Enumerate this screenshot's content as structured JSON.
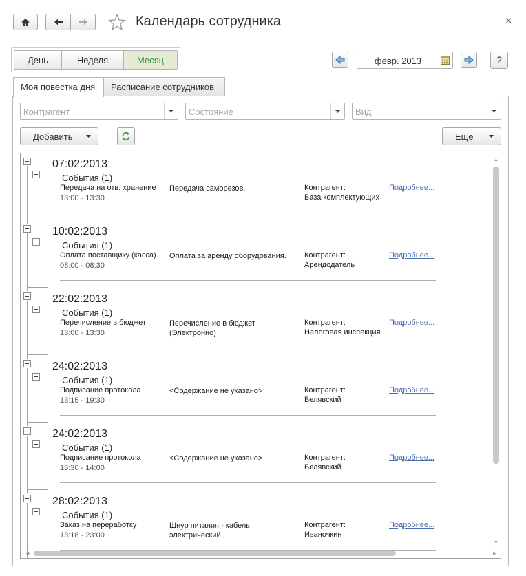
{
  "window": {
    "title": "Календарь сотрудника",
    "close_label": "×"
  },
  "period_switch": [
    {
      "label": "День",
      "active": false
    },
    {
      "label": "Неделя",
      "active": false
    },
    {
      "label": "Месяц",
      "active": true
    }
  ],
  "date_nav": {
    "period": "февр. 2013",
    "help_label": "?"
  },
  "tabs": [
    {
      "label": "Моя повестка дня",
      "active": true
    },
    {
      "label": "Расписание сотрудников",
      "active": false
    }
  ],
  "filters": {
    "counterparty_placeholder": "Контрагент",
    "state_placeholder": "Состояние",
    "kind_placeholder": "Вид"
  },
  "commands": {
    "add_label": "Добавить",
    "more_label": "Еще"
  },
  "groups": [
    {
      "date": "07:02:2013",
      "events": "События (1)",
      "type": "Передача на отв. хранение",
      "time": "13:00 - 13:30",
      "content": "Передача саморезов.",
      "counterparty_label": "Контрагент:",
      "counterparty": "База комплектующих",
      "link": "Подробнее..."
    },
    {
      "date": "10:02:2013",
      "events": "События (1)",
      "type": "Оплата поставщику (касса)",
      "time": "08:00 - 08:30",
      "content": "Оплата за аренду оборудования.",
      "counterparty_label": "Контрагент:",
      "counterparty": "Арендодатель",
      "link": "Подробнее..."
    },
    {
      "date": "22:02:2013",
      "events": "События (1)",
      "type": "Перечисление в бюджет",
      "time": "13:00 - 13:30",
      "content": "Перечисление в бюджет\n(Электронно)",
      "counterparty_label": "Контрагент:",
      "counterparty": "Налоговая инспекция",
      "link": "Подробнее..."
    },
    {
      "date": "24:02:2013",
      "events": "События (1)",
      "type": "Подписание протокола",
      "time": "13:15 - 19:30",
      "content": "<Содержание не указано>",
      "counterparty_label": "Контрагент:",
      "counterparty": "Белявский",
      "link": "Подробнее..."
    },
    {
      "date": "24:02:2013",
      "events": "События (1)",
      "type": "Подписание протокола",
      "time": "13:30 - 14:00",
      "content": "<Содержание не указано>",
      "counterparty_label": "Контрагент:",
      "counterparty": "Белявский",
      "link": "Подробнее..."
    },
    {
      "date": "28:02:2013",
      "events": "События (1)",
      "type": "Заказ на переработку",
      "time": "13:18 - 23:00",
      "content": "Шнур питания - кабель\nэлектрический",
      "counterparty_label": "Контрагент:",
      "counterparty": "Иваночкин",
      "link": "Подробнее..."
    }
  ]
}
